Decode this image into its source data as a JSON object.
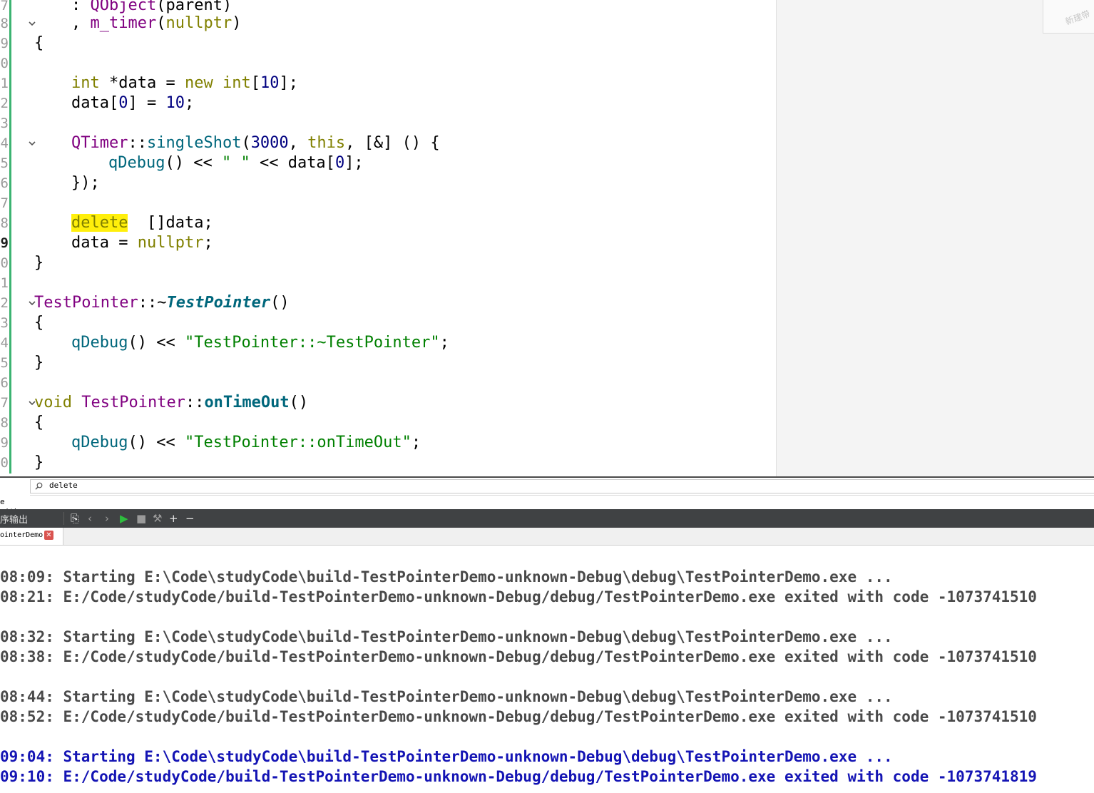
{
  "editor": {
    "line_numbers": [
      "7",
      "8",
      "9",
      "0",
      "1",
      "2",
      "3",
      "4",
      "5",
      "6",
      "7",
      "8",
      "9",
      "0",
      "1",
      "2",
      "3",
      "4",
      "5",
      "6",
      "7",
      "8",
      "9",
      "0"
    ],
    "current_line_index": 12,
    "code": {
      "l0": [
        ": ",
        "QObject",
        "(parent)"
      ],
      "l1": [
        ", ",
        "m_timer",
        "(",
        "nullptr",
        ")"
      ],
      "l2": [
        "{"
      ],
      "l4": [
        "int",
        " *data = ",
        "new",
        " ",
        "int",
        "[",
        "10",
        "];"
      ],
      "l5": [
        "data[",
        "0",
        "] = ",
        "10",
        ";"
      ],
      "l7": [
        "QTimer",
        "::",
        "singleShot",
        "(",
        "3000",
        ", ",
        "this",
        ", [&] () {"
      ],
      "l8": [
        "qDebug",
        "() << ",
        "\" \"",
        " << data[",
        "0",
        "];"
      ],
      "l9": [
        "});"
      ],
      "l11": [
        "delete",
        "  []data;"
      ],
      "l12": [
        "data = ",
        "nullptr",
        ";"
      ],
      "l13": [
        "}"
      ],
      "l15": [
        "TestPointer",
        "::~",
        "TestPointer",
        "()"
      ],
      "l16": [
        "{"
      ],
      "l17": [
        "qDebug",
        "() << ",
        "\"TestPointer::~TestPointer\"",
        ";"
      ],
      "l18": [
        "}"
      ],
      "l20": [
        "void",
        " ",
        "TestPointer",
        "::",
        "onTimeOut",
        "()"
      ],
      "l21": [
        "{"
      ],
      "l22": [
        "qDebug",
        "() << ",
        "\"TestPointer::onTimeOut\"",
        ";"
      ],
      "l23": [
        "}"
      ]
    },
    "notification_text": "新建带"
  },
  "find": {
    "search_value": "delete",
    "replace_label": "e with:"
  },
  "output_pane": {
    "title": "序输出",
    "tab_label": "ointerDemo",
    "tab_close_glyph": "✕",
    "toolbar": {
      "attach": "⎘",
      "prev": "‹",
      "next": "›",
      "run": "▶",
      "stop": "■",
      "debug": "⚒",
      "add": "+",
      "remove": "−"
    },
    "lines": [
      "08:09: Starting E:\\Code\\studyCode\\build-TestPointerDemo-unknown-Debug\\debug\\TestPointerDemo.exe ...",
      "08:21: E:/Code/studyCode/build-TestPointerDemo-unknown-Debug/debug/TestPointerDemo.exe exited with code -1073741510",
      "08:32: Starting E:\\Code\\studyCode\\build-TestPointerDemo-unknown-Debug\\debug\\TestPointerDemo.exe ...",
      "08:38: E:/Code/studyCode/build-TestPointerDemo-unknown-Debug/debug/TestPointerDemo.exe exited with code -1073741510",
      "08:44: Starting E:\\Code\\studyCode\\build-TestPointerDemo-unknown-Debug\\debug\\TestPointerDemo.exe ...",
      "08:52: E:/Code/studyCode/build-TestPointerDemo-unknown-Debug/debug/TestPointerDemo.exe exited with code -1073741510",
      "09:04: Starting E:\\Code\\studyCode\\build-TestPointerDemo-unknown-Debug\\debug\\TestPointerDemo.exe ...",
      "09:10: E:/Code/studyCode/build-TestPointerDemo-unknown-Debug/debug/TestPointerDemo.exe exited with code -1073741819"
    ]
  },
  "colors": {
    "keyword": "#808000",
    "type": "#800080",
    "function": "#00677c",
    "number": "#000080",
    "string": "#008000",
    "search_highlight": "#ffef0b",
    "output_latest": "#1414b4"
  }
}
